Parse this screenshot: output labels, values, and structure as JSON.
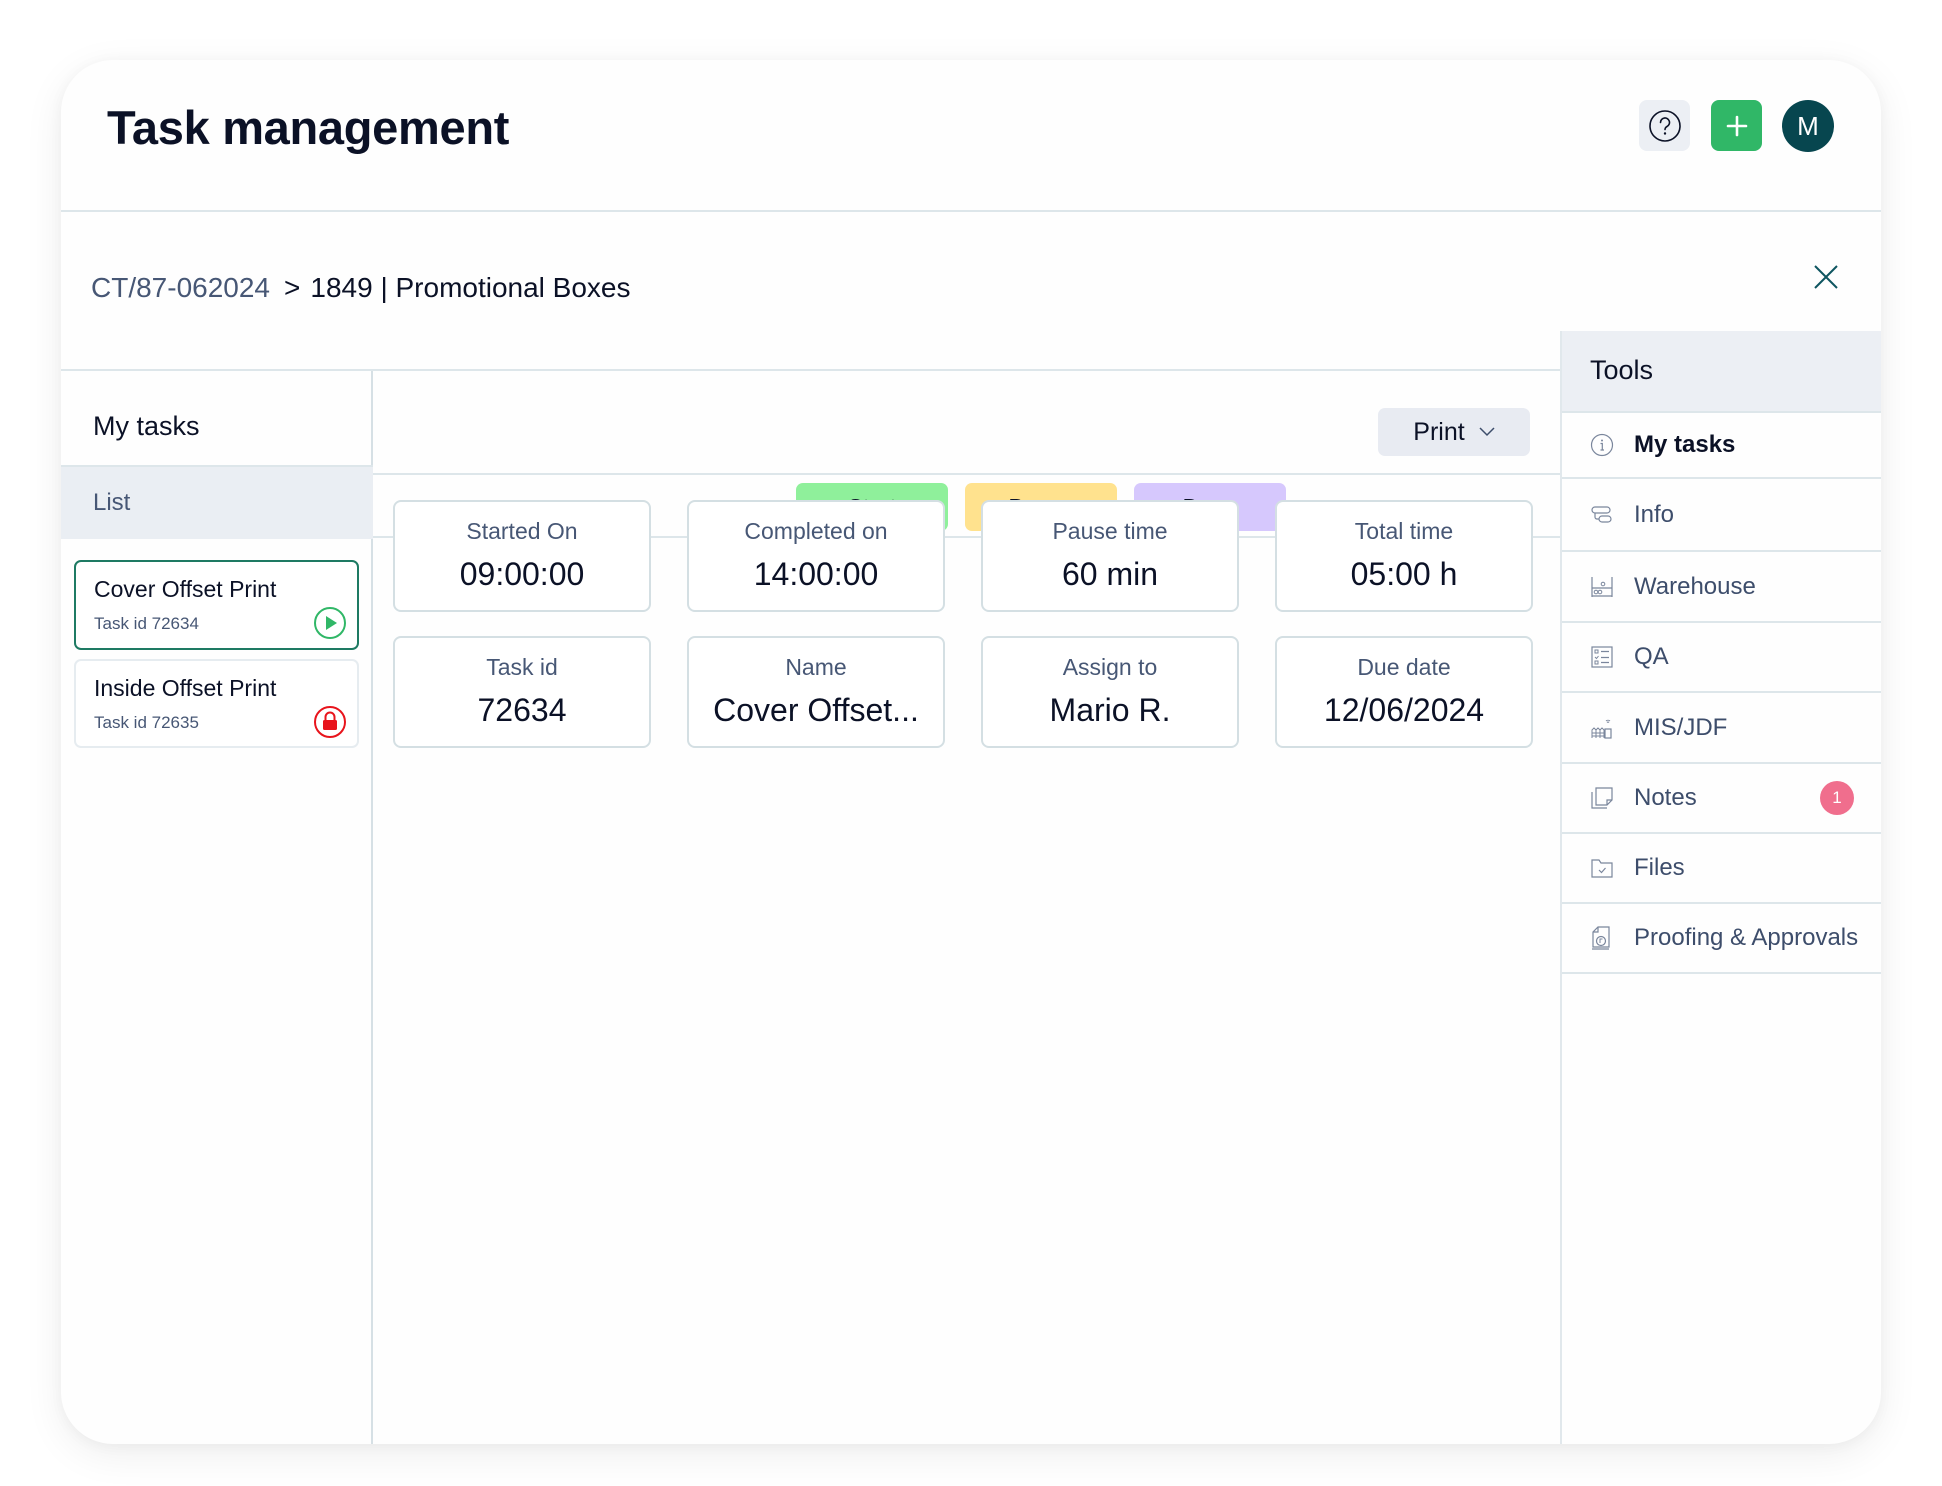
{
  "header": {
    "title": "Task management",
    "help_icon": "question-circle-icon",
    "add_icon": "plus-icon",
    "avatar_initial": "M"
  },
  "breadcrumb": {
    "parent": "CT/87-062024",
    "separator": ">",
    "current": "1849 | Promotional Boxes",
    "close_icon": "close-x-icon"
  },
  "left_panel": {
    "title": "My tasks",
    "list_label": "List",
    "tasks": [
      {
        "name": "Cover Offset Print",
        "id_text": "Task id 72634",
        "status_icon": "play-circle-icon",
        "active": true
      },
      {
        "name": "Inside Offset Print",
        "id_text": "Task id 72635",
        "status_icon": "lock-circle-icon",
        "active": false
      }
    ]
  },
  "toolbar": {
    "print_label": "Print",
    "print_icon": "chevron-down-icon"
  },
  "actions": {
    "start": "Start",
    "pause": "Pause",
    "done": "Done",
    "colors": {
      "start": "#8ff09b",
      "pause": "#ffe28e",
      "done": "#d6c8fd"
    }
  },
  "details": [
    {
      "label": "Started On",
      "value": "09:00:00"
    },
    {
      "label": "Completed on",
      "value": "14:00:00"
    },
    {
      "label": "Pause time",
      "value": "60 min"
    },
    {
      "label": "Total time",
      "value": "05:00 h"
    },
    {
      "label": "Task id",
      "value": "72634"
    },
    {
      "label": "Name",
      "value": "Cover Offset..."
    },
    {
      "label": "Assign to",
      "value": "Mario R."
    },
    {
      "label": "Due date",
      "value": "12/06/2024"
    }
  ],
  "tools": {
    "title": "Tools",
    "items": [
      {
        "label": "My tasks",
        "icon": "info-circle-icon",
        "current": true
      },
      {
        "label": "Info",
        "icon": "info-stack-icon"
      },
      {
        "label": "Warehouse",
        "icon": "warehouse-shelf-icon"
      },
      {
        "label": "QA",
        "icon": "checklist-icon"
      },
      {
        "label": "MIS/JDF",
        "icon": "mis-jdf-icon"
      },
      {
        "label": "Notes",
        "icon": "notes-icon",
        "badge": "1"
      },
      {
        "label": "Files",
        "icon": "folder-check-icon"
      },
      {
        "label": "Proofing & Approvals",
        "icon": "proofing-icon"
      }
    ]
  },
  "colors": {
    "primary_green": "#30b767",
    "avatar_teal": "#07464f",
    "active_border": "#1e7a63",
    "badge_pink": "#f06e8d",
    "lock_red": "#e8141c"
  }
}
